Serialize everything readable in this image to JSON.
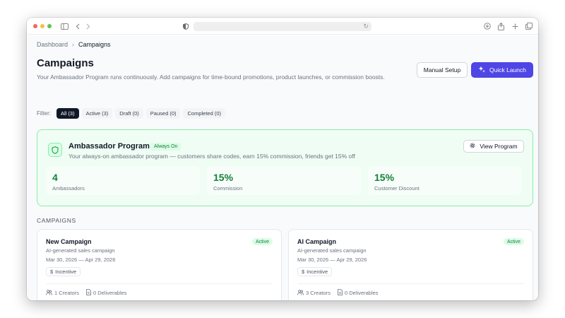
{
  "breadcrumb": {
    "root": "Dashboard",
    "current": "Campaigns"
  },
  "page": {
    "title": "Campaigns",
    "subtitle": "Your Ambassador Program runs continuously. Add campaigns for time-bound promotions, product launches, or commission boosts."
  },
  "actions": {
    "manual_setup": "Manual Setup",
    "quick_launch": "Quick Launch"
  },
  "filters": {
    "label": "Filter:",
    "items": [
      "All (3)",
      "Active (3)",
      "Draft (0)",
      "Paused (0)",
      "Completed (0)"
    ],
    "selected": "All (3)"
  },
  "ambassador": {
    "title": "Ambassador Program",
    "badge": "Always On",
    "description": "Your always-on ambassador program — customers share codes, earn 15% commission, friends get 15% off",
    "view_button": "View Program",
    "stats": [
      {
        "value": "4",
        "label": "Ambassadors"
      },
      {
        "value": "15%",
        "label": "Commission"
      },
      {
        "value": "15%",
        "label": "Customer Discount"
      }
    ]
  },
  "campaigns_section": {
    "label": "CAMPAIGNS",
    "items": [
      {
        "name": "New Campaign",
        "status": "Active",
        "description": "AI-generated sales campaign",
        "dates": "Mar 30, 2026 — Apr 29, 2026",
        "tag": "Incentive",
        "creators": "1 Creators",
        "deliverables": "0 Deliverables"
      },
      {
        "name": "AI Campaign",
        "status": "Active",
        "description": "AI-generated sales campaign",
        "dates": "Mar 30, 2026 — Apr 29, 2026",
        "tag": "Incentive",
        "creators": "3 Creators",
        "deliverables": "0 Deliverables"
      }
    ]
  },
  "colors": {
    "accent": "#4f46e5",
    "success": "#15803d",
    "success_bg": "#f0fdf4",
    "success_border": "#86efac"
  },
  "icons": {
    "shield": "shield-icon",
    "sparkles": "sparkles-icon",
    "gear": "gear-icon",
    "dollar": "dollar-icon",
    "users": "users-icon",
    "document": "document-icon"
  }
}
